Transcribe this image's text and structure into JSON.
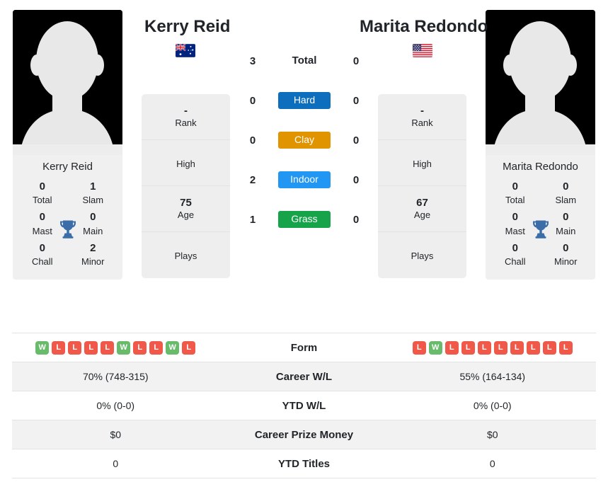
{
  "colors": {
    "win": "#67bb6a",
    "loss": "#f0594a",
    "hard": "#0d6ebd",
    "clay": "#e09400",
    "indoor": "#2196f3",
    "grass": "#16a34a",
    "trophy": "#3b6ea8",
    "row_shade": "#f2f2f2"
  },
  "players": {
    "left": {
      "name": "Kerry Reid",
      "card_name": "Kerry Reid",
      "flag": "australia-flag",
      "avatar": "player-avatar-placeholder",
      "titles": {
        "total_value": "0",
        "total_label": "Total",
        "slam_value": "1",
        "slam_label": "Slam",
        "mast_value": "0",
        "mast_label": "Mast",
        "main_value": "0",
        "main_label": "Main",
        "chall_value": "0",
        "chall_label": "Chall",
        "minor_value": "2",
        "minor_label": "Minor"
      },
      "info": {
        "rank_value": "-",
        "rank_label": "Rank",
        "high_value": "",
        "high_label": "High",
        "age_value": "75",
        "age_label": "Age",
        "plays_value": "",
        "plays_label": "Plays"
      }
    },
    "right": {
      "name": "Marita Redondo",
      "card_name": "Marita Redondo",
      "flag": "usa-flag",
      "avatar": "player-avatar-placeholder",
      "titles": {
        "total_value": "0",
        "total_label": "Total",
        "slam_value": "0",
        "slam_label": "Slam",
        "mast_value": "0",
        "mast_label": "Mast",
        "main_value": "0",
        "main_label": "Main",
        "chall_value": "0",
        "chall_label": "Chall",
        "minor_value": "0",
        "minor_label": "Minor"
      },
      "info": {
        "rank_value": "-",
        "rank_label": "Rank",
        "high_value": "",
        "high_label": "High",
        "age_value": "67",
        "age_label": "Age",
        "plays_value": "",
        "plays_label": "Plays"
      }
    }
  },
  "h2h": {
    "rows": [
      {
        "left": "3",
        "label": "Total",
        "right": "0",
        "type": "total"
      },
      {
        "left": "0",
        "label": "Hard",
        "right": "0",
        "type": "surface",
        "color": "#0d6ebd"
      },
      {
        "left": "0",
        "label": "Clay",
        "right": "0",
        "type": "surface",
        "color": "#e09400"
      },
      {
        "left": "2",
        "label": "Indoor",
        "right": "0",
        "type": "surface",
        "color": "#2196f3"
      },
      {
        "left": "1",
        "label": "Grass",
        "right": "0",
        "type": "surface",
        "color": "#16a34a"
      }
    ]
  },
  "stats": {
    "form": {
      "label": "Form",
      "left": [
        "W",
        "L",
        "L",
        "L",
        "L",
        "W",
        "L",
        "L",
        "W",
        "L"
      ],
      "right": [
        "L",
        "W",
        "L",
        "L",
        "L",
        "L",
        "L",
        "L",
        "L",
        "L"
      ]
    },
    "rows": [
      {
        "label": "Career W/L",
        "left": "70% (748-315)",
        "right": "55% (164-134)"
      },
      {
        "label": "YTD W/L",
        "left": "0% (0-0)",
        "right": "0% (0-0)"
      },
      {
        "label": "Career Prize Money",
        "left": "$0",
        "right": "$0"
      },
      {
        "label": "YTD Titles",
        "left": "0",
        "right": "0"
      }
    ]
  }
}
